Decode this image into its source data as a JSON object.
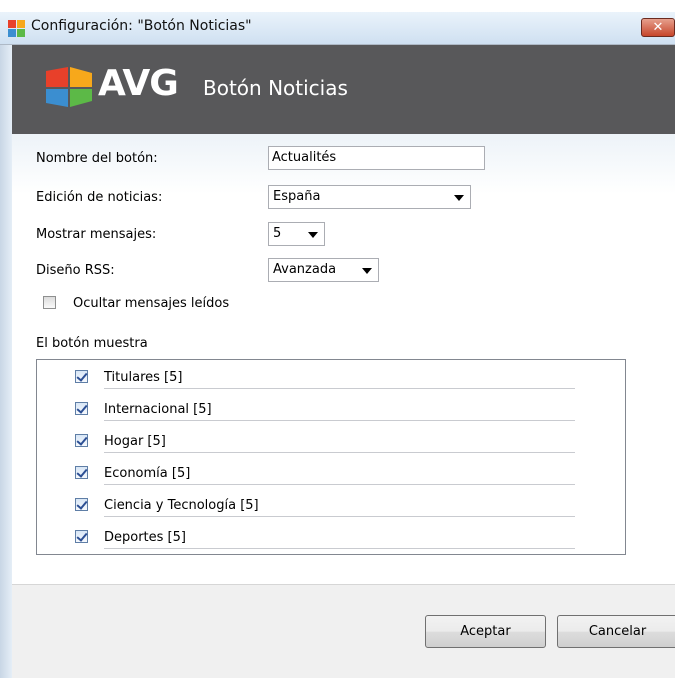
{
  "window": {
    "title": "Configuración: \"Botón Noticias\"",
    "close_label": "✕"
  },
  "banner": {
    "logo_text": "AVG",
    "title": "Botón Noticias"
  },
  "form": {
    "button_name_label": "Nombre del botón:",
    "button_name_value": "Actualités",
    "edition_label": "Edición de noticias:",
    "edition_value": "España",
    "show_messages_label": "Mostrar mensajes:",
    "show_messages_value": "5",
    "rss_design_label": "Diseño RSS:",
    "rss_design_value": "Avanzada",
    "hide_read_label": "Ocultar mensajes leídos",
    "hide_read_checked": false,
    "button_shows_label": "El botón muestra"
  },
  "topics": [
    {
      "label": "Titulares [5]",
      "checked": true
    },
    {
      "label": "Internacional [5]",
      "checked": true
    },
    {
      "label": "Hogar [5]",
      "checked": true
    },
    {
      "label": "Economía [5]",
      "checked": true
    },
    {
      "label": "Ciencia y Tecnología [5]",
      "checked": true
    },
    {
      "label": "Deportes [5]",
      "checked": true
    }
  ],
  "buttons": {
    "accept": "Aceptar",
    "cancel": "Cancelar"
  },
  "colors": {
    "banner_bg": "#58585a",
    "checkmark": "#2c4f94"
  }
}
